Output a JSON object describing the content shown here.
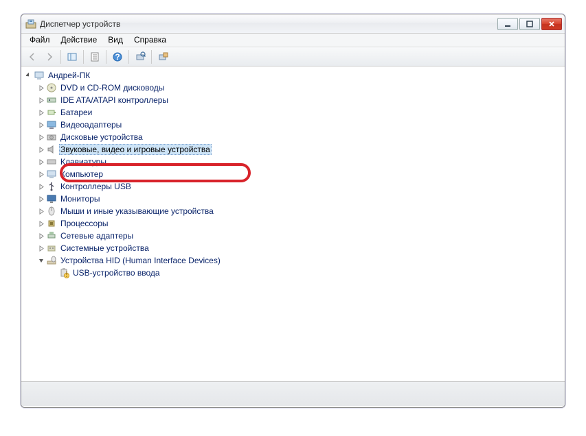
{
  "window": {
    "title": "Диспетчер устройств"
  },
  "menu": {
    "file": "Файл",
    "action": "Действие",
    "view": "Вид",
    "help": "Справка"
  },
  "tree": {
    "root": "Андрей-ПК",
    "items": [
      "DVD и CD-ROM дисководы",
      "IDE ATA/ATAPI контроллеры",
      "Батареи",
      "Видеоадаптеры",
      "Дисковые устройства",
      "Звуковые, видео и игровые устройства",
      "Клавиатуры",
      "Компьютер",
      "Контроллеры USB",
      "Мониторы",
      "Мыши и иные указывающие устройства",
      "Процессоры",
      "Сетевые адаптеры",
      "Системные устройства",
      "Устройства HID (Human Interface Devices)"
    ],
    "hid_child": "USB-устройство ввода"
  }
}
